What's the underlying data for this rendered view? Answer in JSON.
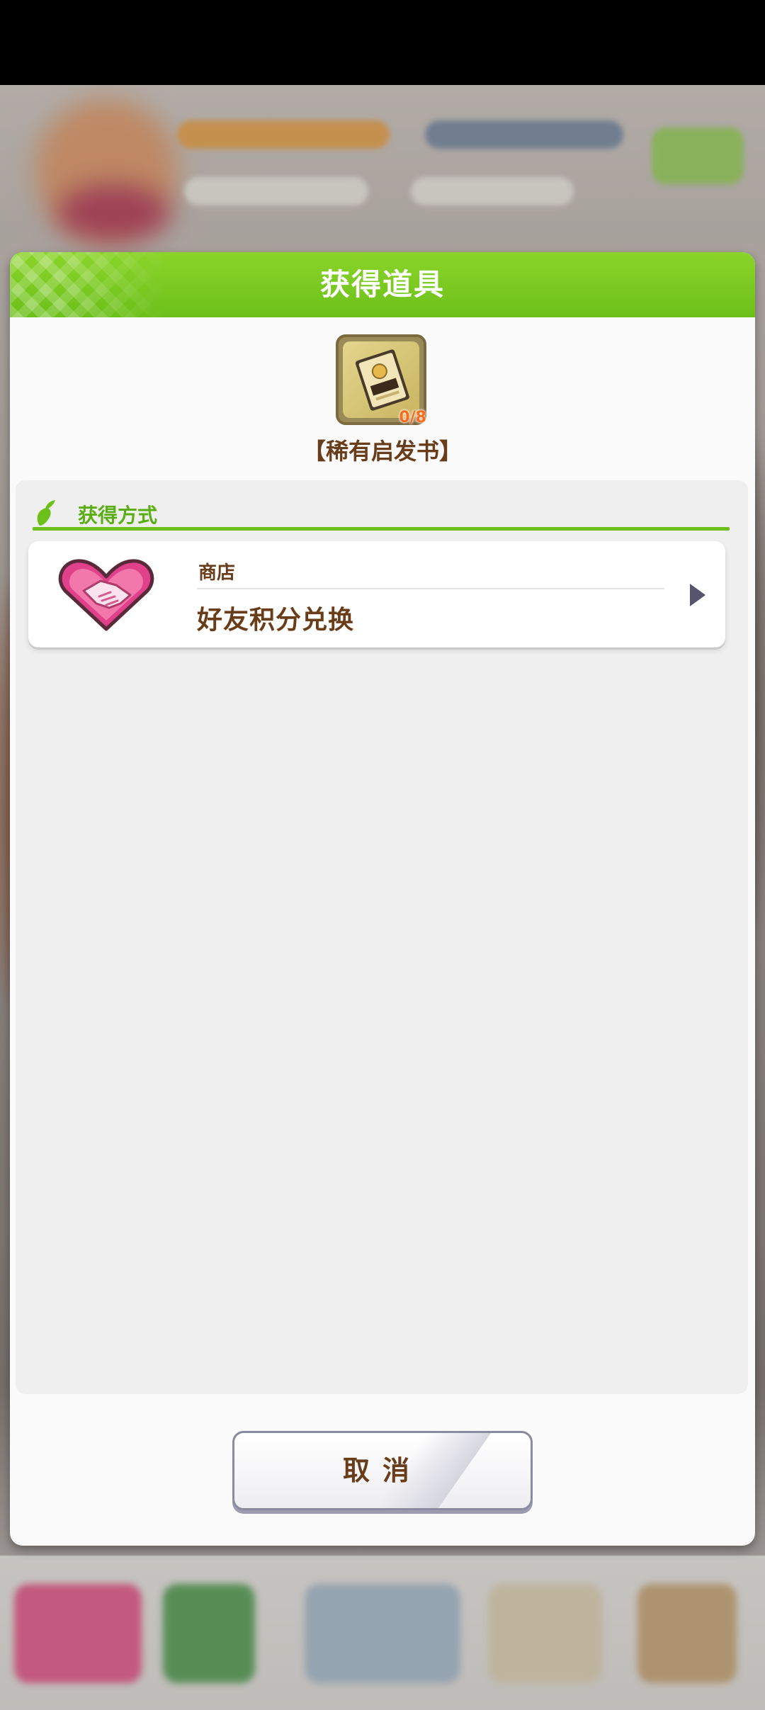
{
  "dialog": {
    "title": "获得道具",
    "item": {
      "name": "【稀有启发书】",
      "count": "0/8",
      "icon": "rare-hint-book-icon"
    },
    "section": {
      "label": "获得方式",
      "icon": "carrot-leaf-icon"
    },
    "sources": [
      {
        "category": "商店",
        "title": "好友积分兑换",
        "icon": "handshake-heart-icon"
      }
    ],
    "cancel_label": "取消"
  },
  "colors": {
    "header_green": "#6cc01a",
    "section_green": "#5aae12",
    "text_brown": "#6a3d1a",
    "count_orange": "#ff6a1a",
    "arrow": "#55556e",
    "handshake_pink": "#e0418a"
  }
}
